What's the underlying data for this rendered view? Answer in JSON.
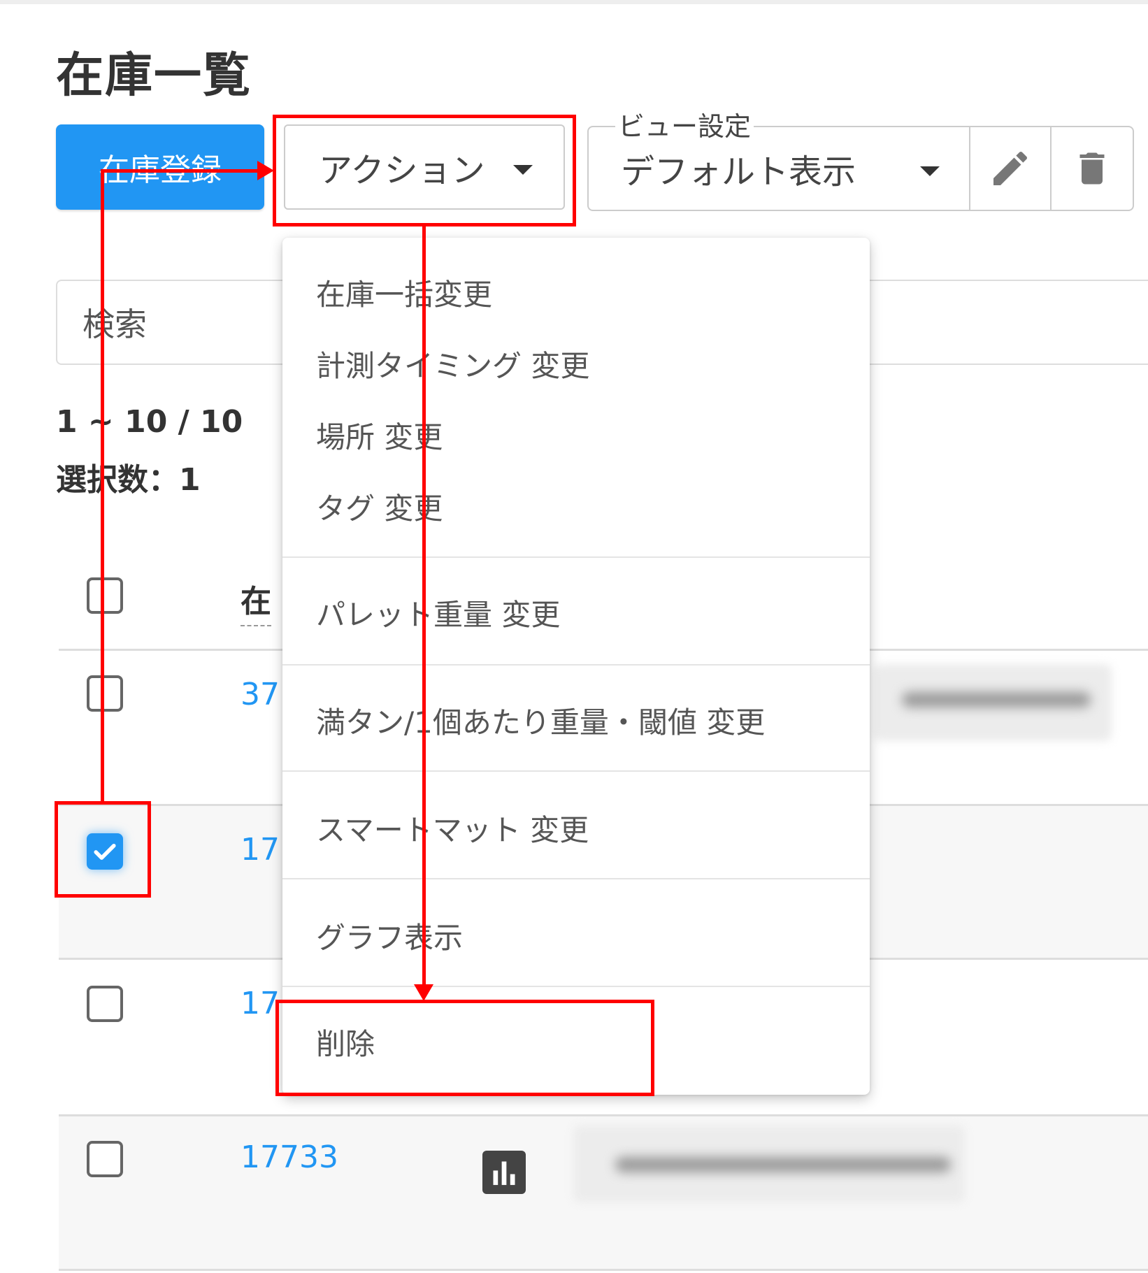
{
  "page": {
    "title": "在庫一覧"
  },
  "toolbar": {
    "register_label": "在庫登録",
    "action_label": "アクション",
    "view_setting_label": "ビュー設定",
    "view_selected": "デフォルト表示"
  },
  "search": {
    "placeholder": "検索"
  },
  "summary": {
    "count": "1 ~ 10 / 10",
    "selected": "選択数：1"
  },
  "table": {
    "column_header": "在",
    "rows": [
      {
        "id": "37",
        "checked": false
      },
      {
        "id": "17",
        "checked": true
      },
      {
        "id": "17",
        "checked": false
      },
      {
        "id": "17733",
        "checked": false
      }
    ]
  },
  "menu": {
    "items": [
      "在庫一括変更",
      "計測タイミング 変更",
      "場所 変更",
      "タグ 変更",
      "パレット重量 変更",
      "満タン/1個あたり重量・閾値 変更",
      "スマートマット 変更",
      "グラフ表示",
      "削除"
    ]
  },
  "colors": {
    "primary": "#2196F3",
    "annotation": "#FF0000",
    "link": "#2196F3"
  },
  "icons": {
    "edit": "pencil-icon",
    "delete": "trash-icon",
    "chart": "bar-chart-icon",
    "caret": "caret-down-icon"
  }
}
